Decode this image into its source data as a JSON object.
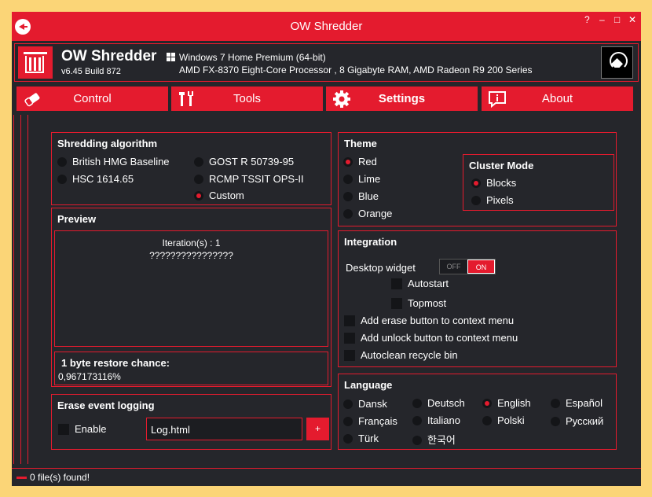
{
  "window": {
    "title": "OW Shredder",
    "help": "?",
    "minimize": "–",
    "maximize": "□",
    "close": "✕"
  },
  "header": {
    "app_name": "OW Shredder",
    "build": "v6.45 Build 872",
    "os": "Windows 7 Home Premium  (64-bit)",
    "hardware": "AMD FX-8370 Eight-Core Processor , 8 Gigabyte RAM, AMD Radeon R9 200 Series"
  },
  "tabs": [
    {
      "label": "Control",
      "icon": "eraser-icon"
    },
    {
      "label": "Tools",
      "icon": "tools-icon"
    },
    {
      "label": "Settings",
      "icon": "gear-icon",
      "active": true
    },
    {
      "label": "About",
      "icon": "info-icon"
    }
  ],
  "shredding": {
    "title": "Shredding algorithm",
    "options": [
      {
        "label": "British HMG Baseline",
        "selected": false
      },
      {
        "label": "HSC 1614.65",
        "selected": false
      },
      {
        "label": "GOST R 50739-95",
        "selected": false
      },
      {
        "label": "RCMP TSSIT OPS-II",
        "selected": false
      },
      {
        "label": "Custom",
        "selected": true
      }
    ]
  },
  "preview": {
    "title": "Preview",
    "iterations": "Iteration(s) : 1",
    "pattern": "????????????????"
  },
  "restore": {
    "title": "1 byte restore chance:",
    "value": "0,967173116%"
  },
  "logging": {
    "title": "Erase event logging",
    "enable_label": "Enable",
    "file": "Log.html",
    "add_label": "+"
  },
  "theme": {
    "title": "Theme",
    "options": [
      {
        "label": "Red",
        "selected": true
      },
      {
        "label": "Lime",
        "selected": false
      },
      {
        "label": "Blue",
        "selected": false
      },
      {
        "label": "Orange",
        "selected": false
      }
    ]
  },
  "cluster": {
    "title": "Cluster Mode",
    "options": [
      {
        "label": "Blocks",
        "selected": true
      },
      {
        "label": "Pixels",
        "selected": false
      }
    ]
  },
  "integration": {
    "title": "Integration",
    "widget_label": "Desktop widget",
    "toggle_off": "OFF",
    "toggle_on": "ON",
    "autostart": "Autostart",
    "topmost": "Topmost",
    "erase_ctx": "Add erase button to context menu",
    "unlock_ctx": "Add unlock button to context menu",
    "recycle": "Autoclean recycle bin"
  },
  "language": {
    "title": "Language",
    "options": [
      {
        "label": "Dansk",
        "selected": false
      },
      {
        "label": "Deutsch",
        "selected": false
      },
      {
        "label": "English",
        "selected": true
      },
      {
        "label": "Español",
        "selected": false
      },
      {
        "label": "Français",
        "selected": false
      },
      {
        "label": "Italiano",
        "selected": false
      },
      {
        "label": "Polski",
        "selected": false
      },
      {
        "label": "Русский",
        "selected": false
      },
      {
        "label": "Türk",
        "selected": false
      },
      {
        "label": "한국어",
        "selected": false
      }
    ]
  },
  "status": {
    "text": "0 file(s) found!"
  },
  "colors": {
    "accent": "#e41b2e",
    "background": "#25262b",
    "frame": "#fbd577"
  }
}
